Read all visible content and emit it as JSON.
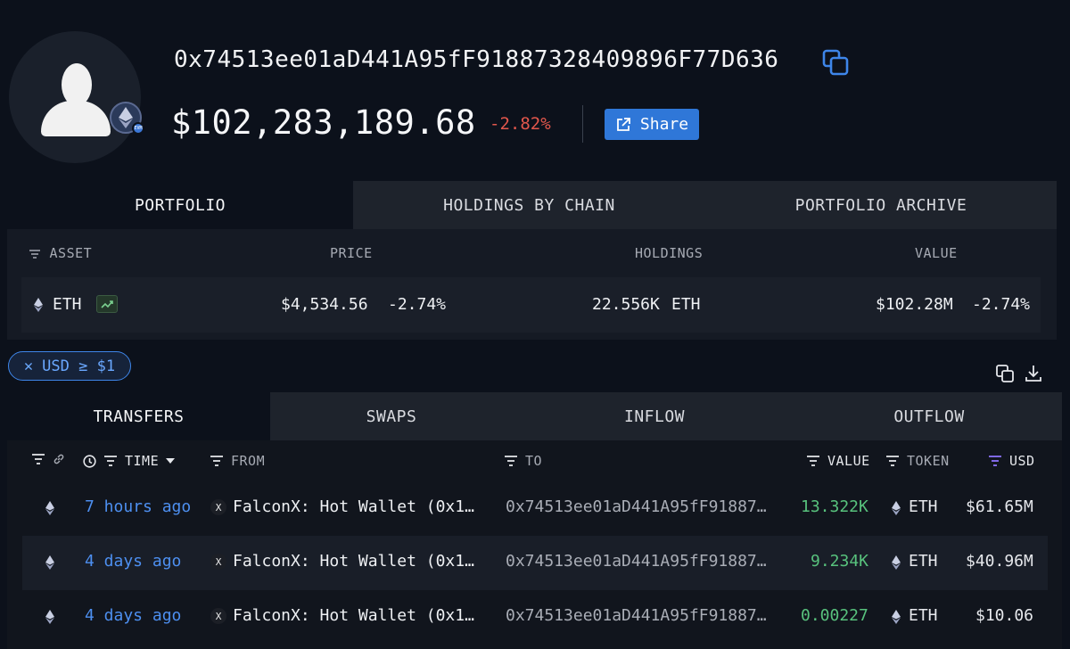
{
  "header": {
    "address": "0x74513ee01aD441A95fF91887328409896F77D636",
    "balance": "$102,283,189.68",
    "balance_change": "-2.82%",
    "share_label": "Share",
    "chain_badge": "EVM"
  },
  "portfolio_tabs": [
    "PORTFOLIO",
    "HOLDINGS BY CHAIN",
    "PORTFOLIO ARCHIVE"
  ],
  "portfolio_columns": {
    "asset": "ASSET",
    "price": "PRICE",
    "holdings": "HOLDINGS",
    "value": "VALUE"
  },
  "assets": [
    {
      "symbol": "ETH",
      "price": "$4,534.56",
      "price_change": "-2.74%",
      "holdings": "22.556K",
      "holdings_unit": "ETH",
      "value": "$102.28M",
      "value_change": "-2.74%"
    }
  ],
  "filter_chip": {
    "label": "USD ≥ $1"
  },
  "transfer_tabs": [
    "TRANSFERS",
    "SWAPS",
    "INFLOW",
    "OUTFLOW"
  ],
  "transfer_columns": {
    "time": "TIME",
    "from": "FROM",
    "to": "TO",
    "value": "VALUE",
    "token": "TOKEN",
    "usd": "USD"
  },
  "transfers": [
    {
      "time": "7 hours ago",
      "from": "FalconX: Hot Wallet (0x1…",
      "to": "0x74513ee01aD441A95fF91887…",
      "value": "13.322K",
      "token": "ETH",
      "usd": "$61.65M"
    },
    {
      "time": "4 days ago",
      "from": "FalconX: Hot Wallet (0x1…",
      "to": "0x74513ee01aD441A95fF91887…",
      "value": "9.234K",
      "token": "ETH",
      "usd": "$40.96M"
    },
    {
      "time": "4 days ago",
      "from": "FalconX: Hot Wallet (0x1…",
      "to": "0x74513ee01aD441A95fF91887…",
      "value": "0.00227",
      "token": "ETH",
      "usd": "$10.06"
    }
  ],
  "colors": {
    "background": "#0c111b",
    "accent": "#2f77d8",
    "negative": "#e2574c",
    "positive": "#58c27d",
    "link": "#4d8ff0"
  }
}
